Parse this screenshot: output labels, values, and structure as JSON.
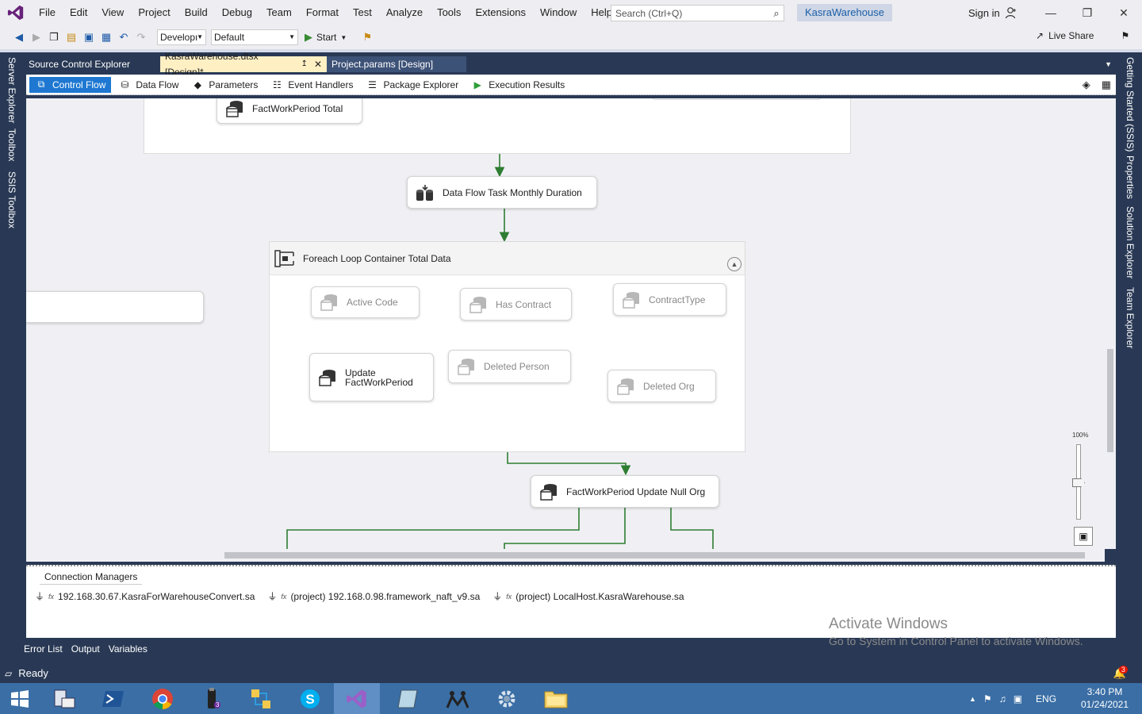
{
  "menubar": {
    "items": [
      "File",
      "Edit",
      "View",
      "Project",
      "Build",
      "Debug",
      "Team",
      "Format",
      "Test",
      "Analyze",
      "Tools",
      "Extensions",
      "Window",
      "Help"
    ],
    "search_placeholder": "Search (Ctrl+Q)",
    "solution_name": "KasraWarehouse",
    "signin": "Sign in"
  },
  "toolbar": {
    "config": "Developı",
    "platform": "Default",
    "start": "Start",
    "live_share": "Live Share"
  },
  "left_rail": [
    "Server Explorer",
    "Toolbox",
    "SSIS Toolbox"
  ],
  "right_rail": [
    "Getting Started (SSIS)",
    "Properties",
    "Solution Explorer",
    "Team Explorer"
  ],
  "doc_tabs": [
    {
      "label": "Source Control Explorer"
    },
    {
      "label": "KasraWarehouse.dtsx [Design]*"
    },
    {
      "label": "Project.params [Design]"
    }
  ],
  "designer_tabs": [
    "Control Flow",
    "Data Flow",
    "Parameters",
    "Event Handlers",
    "Package Explorer",
    "Execution Results"
  ],
  "canvas": {
    "tasks": {
      "factworkperiod_total": "FactWorkPeriod Total",
      "data_flow_monthly": "Data Flow Task Monthly Duration",
      "foreach_container": "Foreach Loop Container Total Data",
      "active_code": "Active Code",
      "has_contract": "Has Contract",
      "contract_type": "ContractType",
      "update_factworkperiod": "Update FactWorkPeriod",
      "deleted_person": "Deleted Person",
      "deleted_org": "Deleted Org",
      "update_null_org": "FactWorkPeriod Update Null Org"
    },
    "zoom": "100%"
  },
  "connection_managers": {
    "tab": "Connection Managers",
    "items": [
      "192.168.30.67.KasraForWarehouseConvert.sa",
      "(project) 192.168.0.98.framework_naft_v9.sa",
      "(project) LocalHost.KasraWarehouse.sa"
    ]
  },
  "watermark": {
    "title": "Activate Windows",
    "subtitle": "Go to System in Control Panel to activate Windows."
  },
  "bottom_tabs": [
    "Error List",
    "Output",
    "Variables"
  ],
  "status": {
    "text": "Ready",
    "notifications": "3"
  },
  "taskbar": {
    "language": "ENG",
    "time": "3:40 PM",
    "date": "01/24/2021",
    "usb_badge": "3"
  },
  "colors": {
    "accent": "#1e78d1",
    "rail": "#293955",
    "arrow": "#2e7d32",
    "taskbar": "#3a6ea5"
  }
}
